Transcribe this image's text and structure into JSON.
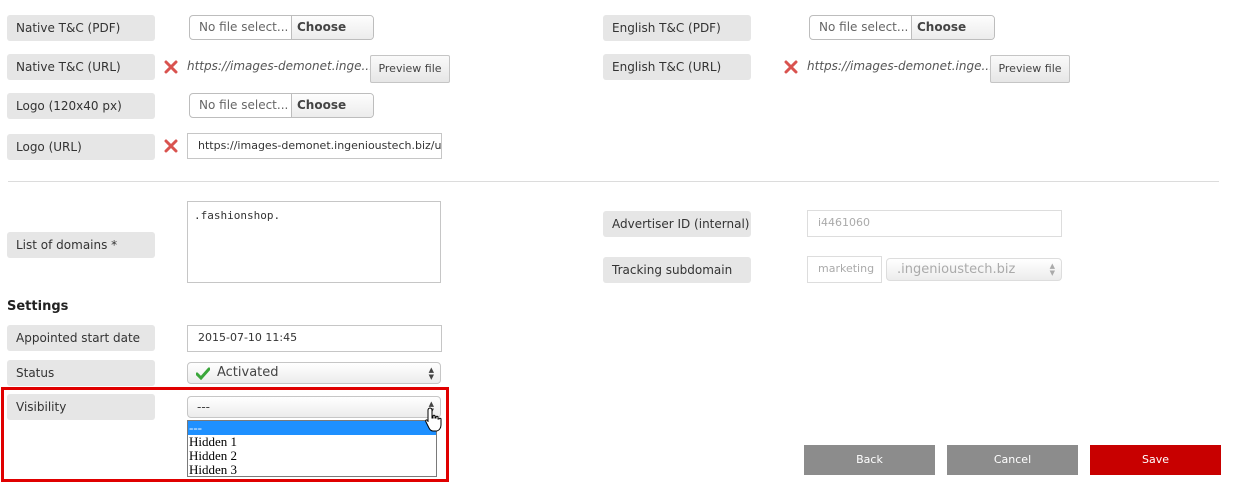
{
  "files": {
    "placeholder": "No file select...",
    "choose_label": "Choose File",
    "preview_label": "Preview file"
  },
  "labels": {
    "native_tc_pdf": "Native T&C (PDF)",
    "native_tc_url": "Native T&C (URL)",
    "logo_120x40": "Logo (120x40 px)",
    "logo_url": "Logo (URL)",
    "english_tc_pdf": "English T&C (PDF)",
    "english_tc_url": "English T&C (URL)",
    "list_of_domains": "List of domains *",
    "advertiser_id": "Advertiser ID (internal)",
    "tracking_subdomain": "Tracking subdomain",
    "appointed_start_date": "Appointed start date",
    "status": "Status",
    "visibility": "Visibility"
  },
  "values": {
    "native_tc_url": "https://images-demonet.inge...",
    "english_tc_url": "https://images-demonet.inge...",
    "logo_url": "https://images-demonet.ingenioustech.biz/uploade",
    "domains": ".fashionshop.",
    "advertiser_id": "i4461060",
    "tracking_prefix": "marketing",
    "tracking_domain": ".ingenioustech.biz",
    "appointed_start_date": "2015-07-10 11:45",
    "status": "Activated",
    "visibility": "---"
  },
  "settings_title": "Settings",
  "visibility_options": [
    "---",
    "Hidden 1",
    "Hidden 2",
    "Hidden 3"
  ],
  "actions": {
    "back": "Back",
    "cancel": "Cancel",
    "save": "Save"
  },
  "colors": {
    "save": "#c80000",
    "secondary": "#8c8c8c",
    "highlight": "#e00000",
    "selected_option": "#1e90ff",
    "check": "#3aa63a",
    "remove_x": "#d9534f"
  },
  "icons": {
    "remove": "x-icon",
    "status": "checkmark-icon",
    "cursor": "hand-cursor-icon"
  }
}
